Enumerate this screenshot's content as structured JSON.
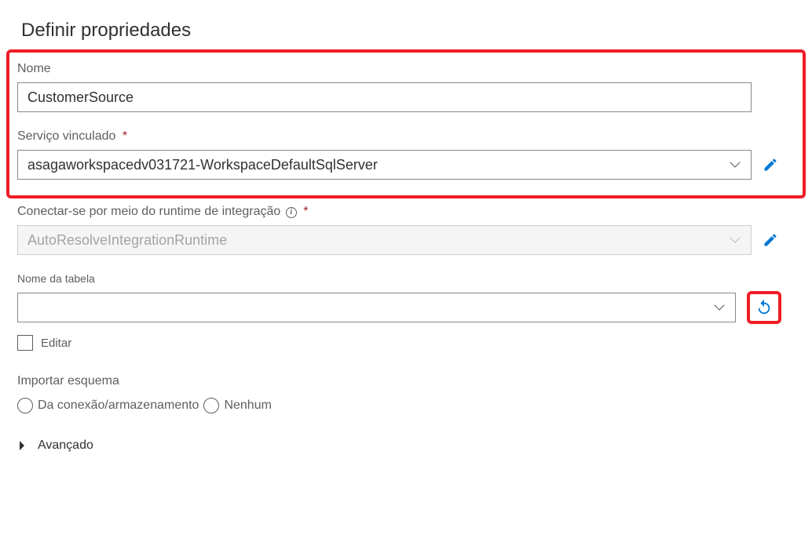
{
  "title": "Definir propriedades",
  "form": {
    "name": {
      "label": "Nome",
      "value": "CustomerSource"
    },
    "linkedService": {
      "label": "Serviço vinculado",
      "required": true,
      "value": "asagaworkspacedv031721-WorkspaceDefaultSqlServer"
    },
    "integrationRuntime": {
      "label": "Conectar-se por meio do runtime de integração",
      "required": true,
      "value": "AutoResolveIntegrationRuntime"
    },
    "tableName": {
      "label": "Nome da tabela",
      "value": ""
    },
    "editCheckbox": {
      "label": "Editar"
    },
    "importSchema": {
      "label": "Importar esquema",
      "options": {
        "fromConnection": "Da conexão/armazenamento",
        "none": "Nenhum"
      }
    },
    "advanced": {
      "label": "Avançado"
    }
  },
  "icons": {
    "edit": "pencil-icon",
    "refresh": "refresh-icon",
    "info": "info-icon",
    "chevronDown": "chevron-down-icon",
    "chevronRight": "chevron-right-icon"
  }
}
